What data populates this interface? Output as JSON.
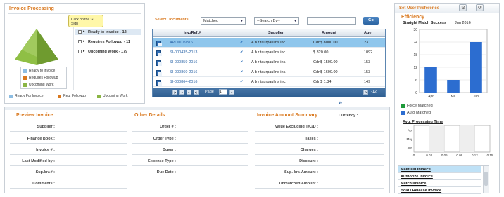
{
  "invoice_processing": {
    "title": "Invoice Processing",
    "tooltip": "Click on the '+' Sign",
    "tree_items": [
      {
        "label": "Ready to Invoice - 12",
        "selected": true
      },
      {
        "label": "Requires Followup - 11",
        "selected": false
      },
      {
        "label": "Upcoming Work - 179",
        "selected": false
      }
    ],
    "pyramid_legend": [
      "Ready to Invoice",
      "Requires Followup",
      "Upcoming Work"
    ],
    "bottom_legend": [
      {
        "label": "Ready For Invoice",
        "color": "#8dbde2"
      },
      {
        "label": "Req. Followup",
        "color": "#d9781e"
      },
      {
        "label": "Upcoming Work",
        "color": "#8ab544"
      }
    ],
    "pyramid_colors": {
      "top": "#a8cf6a",
      "left": "#8fbf45",
      "right": "#6f9b2f"
    }
  },
  "documents": {
    "select_label": "Select Documents",
    "filter_value": "Matched",
    "search_by_value": "--Search By--",
    "search_value": "",
    "go_label": "Go",
    "columns": [
      "Inv./Ref.#",
      "Supplier",
      "Amount",
      "Age"
    ],
    "rows": [
      {
        "ref": "APO0079316",
        "supplier": "A b r taurpaulins inc.",
        "amount": "Cdn$ 8000.00",
        "age": "23",
        "selected": true
      },
      {
        "ref": "SI-000435-2013",
        "supplier": "A b r taurpaulins inc.",
        "amount": "$ 320.00",
        "age": "1092",
        "selected": false
      },
      {
        "ref": "SI-000859-2016",
        "supplier": "A b r taurpaulins inc.",
        "amount": "Cdn$ 1500.00",
        "age": "153",
        "selected": false
      },
      {
        "ref": "SI-000860-2016",
        "supplier": "A b r taurpaulins inc.",
        "amount": "Cdn$ 1600.00",
        "age": "153",
        "selected": false
      },
      {
        "ref": "SI-000864-2016",
        "supplier": "A b r taurpaulins inc.",
        "amount": "Cdn$ 1.34",
        "age": "149",
        "selected": false
      }
    ],
    "page_label": "Page",
    "page_value": "1",
    "record_count": "-12"
  },
  "preview": {
    "title": "Preview Invoice",
    "fields": [
      "Supplier :",
      "Finance Book :",
      "Invoice # :",
      "Last Modified by :",
      "Sup.Inv.# :",
      "Comments :"
    ]
  },
  "other_details": {
    "title": "Other Details",
    "fields": [
      "Order # :",
      "Order Type :",
      "Buyer :",
      "Expense Type :",
      "Due Date :"
    ]
  },
  "amount_summary": {
    "title": "Invoice Amount Summary",
    "currency_label": "Currency :",
    "fields": [
      "Value Excluding T/C/D :",
      "Taxes :",
      "Charges :",
      "Discount :",
      "Sup. Inv. Amount :",
      "Unmatched Amount :"
    ]
  },
  "right_panel": {
    "title": "Set User Preference",
    "efficiency_title": "Efficiency",
    "straight_match_label": "Straight Match Success",
    "date_label": "Jun 2016",
    "legend": [
      {
        "label": "Force Matched",
        "color": "#1e9a3a"
      },
      {
        "label": "Auto Matched",
        "color": "#2c6dd0"
      }
    ],
    "avg_time_title": "Avg. Processing Time",
    "quick_links": [
      "Maintain Invoice",
      "Authorize Invoice",
      "Match Invoice",
      "Hold / Release Invoice"
    ]
  },
  "chart_data": [
    {
      "type": "bar",
      "title": "Straight Match Success",
      "categories": [
        "Apr",
        "Ma",
        "Jun"
      ],
      "values": [
        12,
        6,
        24
      ],
      "ylim": [
        0,
        30
      ],
      "yticks": [
        "0",
        "6",
        "12",
        "18",
        "24",
        "30"
      ],
      "color": "#2c6dd0",
      "grid": true
    },
    {
      "type": "bar",
      "title": "Avg. Processing Time",
      "orientation": "horizontal",
      "categories": [
        "Apr",
        "May",
        "Jun"
      ],
      "values": [
        0,
        0,
        0
      ],
      "xlim": [
        0,
        0.15
      ],
      "xticks": [
        "0",
        "0.03",
        "0.06",
        "0.09",
        "0.12",
        "0.15"
      ],
      "grid": true
    }
  ]
}
